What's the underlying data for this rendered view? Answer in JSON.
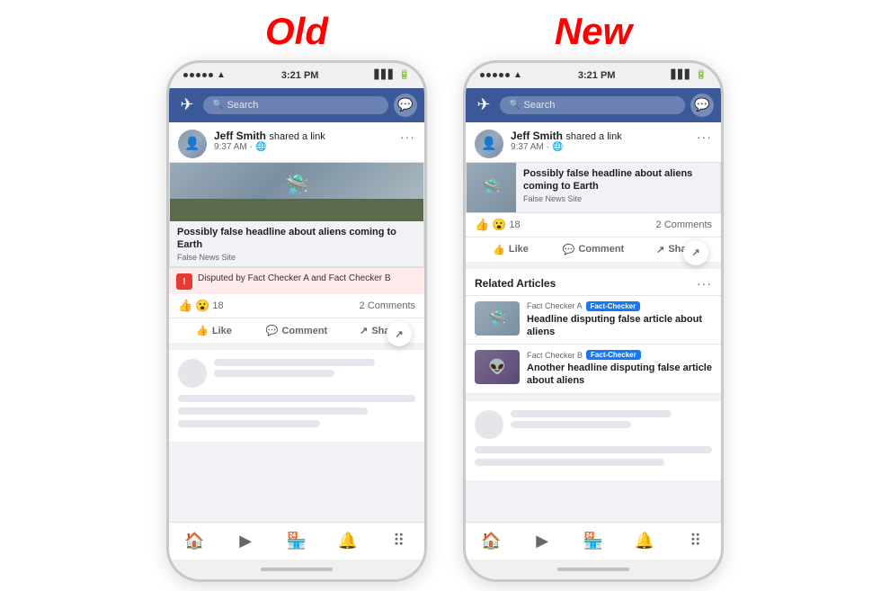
{
  "labels": {
    "old": "Old",
    "new": "New"
  },
  "status_bar": {
    "dots": 5,
    "time": "3:21 PM",
    "signal": "▲",
    "wifi": "wifi",
    "battery": "battery"
  },
  "facebook": {
    "search_placeholder": "Search",
    "post": {
      "author": "Jeff Smith",
      "action": "shared a link",
      "time": "9:37 AM",
      "privacy": "🌐",
      "headline": "Possibly false headline about aliens coming to Earth",
      "source": "False News Site",
      "disputed_text": "Disputed by Fact Checker A and Fact Checker B",
      "reactions_count": "18",
      "comments_count": "2 Comments"
    },
    "actions": {
      "like": "Like",
      "comment": "Comment",
      "share": "Share"
    },
    "related": {
      "title": "Related Articles",
      "items": [
        {
          "checker": "Fact Checker A",
          "badge": "Fact-Checker",
          "headline": "Headline disputing false article about aliens"
        },
        {
          "checker": "Fact Checker B",
          "badge": "Fact-Checker",
          "headline": "Another headline disputing false article about aliens"
        }
      ]
    }
  }
}
